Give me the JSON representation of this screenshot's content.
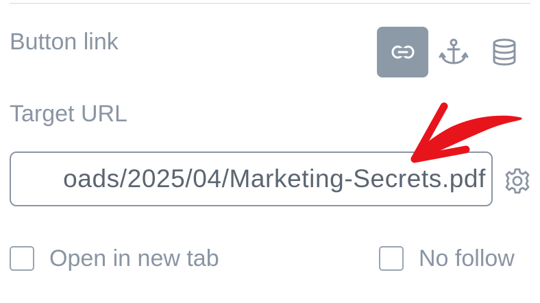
{
  "button_link": {
    "label": "Button link",
    "link_types": [
      {
        "name": "url",
        "icon": "link-icon",
        "active": true
      },
      {
        "name": "anchor",
        "icon": "anchor-icon",
        "active": false
      },
      {
        "name": "dynamic",
        "icon": "database-icon",
        "active": false
      }
    ]
  },
  "target_url": {
    "label": "Target URL",
    "value": "oads/2025/04/Marketing-Secrets.pdf",
    "settings_icon": "gear-icon"
  },
  "options": {
    "open_new_tab": {
      "label": "Open in new tab",
      "checked": false
    },
    "no_follow": {
      "label": "No follow",
      "checked": false
    }
  },
  "colors": {
    "label": "#8a95a3",
    "active_button": "#8c9aa8",
    "annotation_arrow": "#e8141c"
  }
}
